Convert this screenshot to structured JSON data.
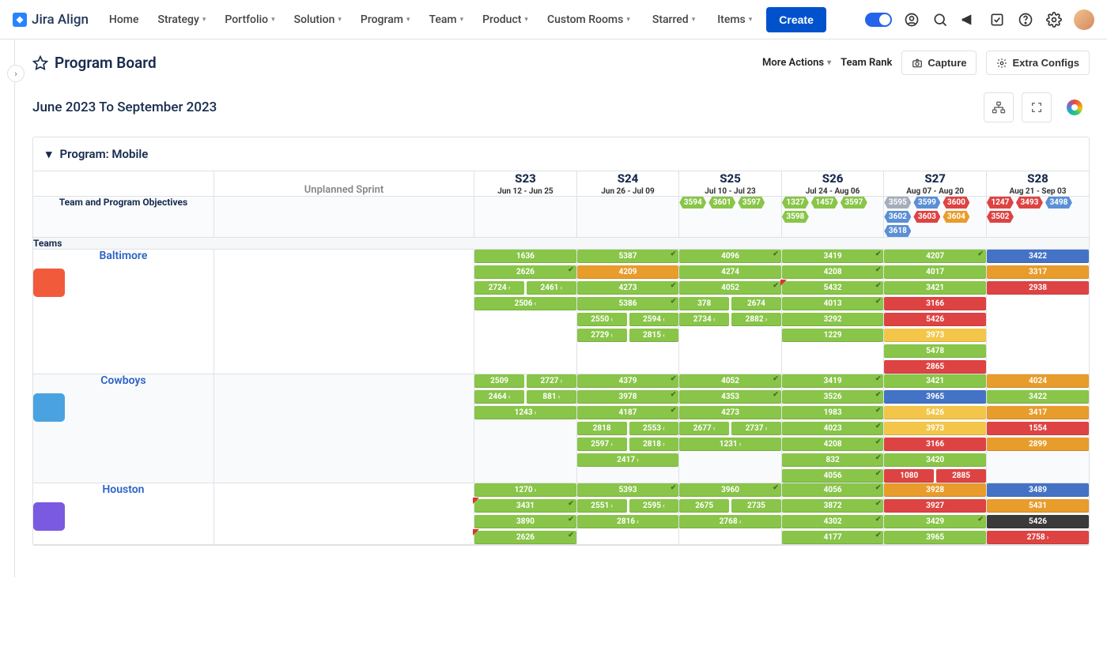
{
  "app": {
    "name": "Jira Align"
  },
  "nav": {
    "items": [
      "Home",
      "Strategy",
      "Portfolio",
      "Solution",
      "Program",
      "Team",
      "Product",
      "Custom Rooms"
    ],
    "items_dropdown": [
      false,
      true,
      true,
      true,
      true,
      true,
      true,
      true
    ],
    "starred": "Starred",
    "items_label": "Items",
    "create": "Create"
  },
  "header": {
    "title": "Program Board",
    "more_actions": "More Actions",
    "team_rank": "Team Rank",
    "capture": "Capture",
    "extra_configs": "Extra Configs"
  },
  "date_range": "June 2023 To September 2023",
  "board": {
    "program_label": "Program: Mobile",
    "unplanned_label": "Unplanned Sprint",
    "objectives_label": "Team and Program Objectives",
    "teams_label": "Teams",
    "sprints": [
      {
        "id": "S23",
        "range": "Jun 12 - Jun 25"
      },
      {
        "id": "S24",
        "range": "Jun 26 - Jul 09"
      },
      {
        "id": "S25",
        "range": "Jul 10 - Jul 23"
      },
      {
        "id": "S26",
        "range": "Jul 24 - Aug 06"
      },
      {
        "id": "S27",
        "range": "Aug 07 - Aug 20"
      },
      {
        "id": "S28",
        "range": "Aug 21 - Sep 03"
      }
    ],
    "objectives": {
      "S23": [],
      "S24": [],
      "S25": [
        {
          "id": "3594",
          "c": "green"
        },
        {
          "id": "3601",
          "c": "green"
        },
        {
          "id": "3597",
          "c": "green"
        }
      ],
      "S26": [
        {
          "id": "1327",
          "c": "green"
        },
        {
          "id": "1457",
          "c": "green"
        },
        {
          "id": "3597",
          "c": "green"
        },
        {
          "id": "3598",
          "c": "green"
        }
      ],
      "S27": [
        {
          "id": "3595",
          "c": "gray"
        },
        {
          "id": "3599",
          "c": "blue"
        },
        {
          "id": "3600",
          "c": "red"
        },
        {
          "id": "3602",
          "c": "blue"
        },
        {
          "id": "3603",
          "c": "red"
        },
        {
          "id": "3604",
          "c": "orange"
        },
        {
          "id": "3618",
          "c": "blue"
        }
      ],
      "S28": [
        {
          "id": "1247",
          "c": "red"
        },
        {
          "id": "3493",
          "c": "red"
        },
        {
          "id": "3498",
          "c": "blue"
        },
        {
          "id": "3502",
          "c": "red"
        }
      ]
    },
    "teams": [
      {
        "name": "Baltimore",
        "avatar_bg": "#f25a3c",
        "cells": {
          "S23": [
            {
              "id": "1636",
              "c": "green",
              "tick": false
            },
            {
              "id": "2626",
              "c": "green",
              "tick": true
            },
            {
              "pair": [
                {
                  "id": "2724",
                  "c": "green",
                  "arr": "‹"
                },
                {
                  "id": "2461",
                  "c": "green",
                  "arr": "‹"
                }
              ]
            },
            {
              "pair": [
                {
                  "id": "2506",
                  "c": "green",
                  "arr": "‹"
                }
              ]
            }
          ],
          "S24": [
            {
              "id": "5387",
              "c": "green",
              "tick": true
            },
            {
              "id": "4209",
              "c": "orange"
            },
            {
              "id": "4273",
              "c": "green",
              "tick": true
            },
            {
              "id": "5386",
              "c": "green",
              "tick": true
            },
            {
              "pair": [
                {
                  "id": "2550",
                  "c": "green",
                  "arr": "‹"
                },
                {
                  "id": "2594",
                  "c": "green",
                  "arr": "‹"
                }
              ]
            },
            {
              "pair": [
                {
                  "id": "2729",
                  "c": "green",
                  "arr": "‹"
                },
                {
                  "id": "2815",
                  "c": "green",
                  "arr": "‹"
                }
              ]
            }
          ],
          "S25": [
            {
              "id": "4096",
              "c": "green",
              "tick": true
            },
            {
              "id": "4274",
              "c": "green"
            },
            {
              "id": "4052",
              "c": "green",
              "tick": true
            },
            {
              "pair": [
                {
                  "id": "378",
                  "c": "green"
                },
                {
                  "id": "2674",
                  "c": "green"
                }
              ]
            },
            {
              "pair": [
                {
                  "id": "2734",
                  "c": "green",
                  "arr": "‹"
                },
                {
                  "id": "2882",
                  "c": "green",
                  "arr": "›"
                }
              ]
            }
          ],
          "S26": [
            {
              "id": "3419",
              "c": "green",
              "tick": true
            },
            {
              "id": "4208",
              "c": "green",
              "tick": true
            },
            {
              "id": "5432",
              "c": "green",
              "tick": true,
              "flag": true
            },
            {
              "id": "4013",
              "c": "green",
              "tick": true
            },
            {
              "id": "3292",
              "c": "green"
            },
            {
              "pair": [
                {
                  "id": "1229",
                  "c": "green"
                }
              ]
            }
          ],
          "S27": [
            {
              "id": "4207",
              "c": "green",
              "tick": true
            },
            {
              "id": "4017",
              "c": "green"
            },
            {
              "id": "3421",
              "c": "green"
            },
            {
              "id": "3166",
              "c": "red"
            },
            {
              "id": "5426",
              "c": "red"
            },
            {
              "id": "3973",
              "c": "yellow"
            },
            {
              "id": "5478",
              "c": "green"
            },
            {
              "pair": [
                {
                  "id": "2865",
                  "c": "red"
                }
              ]
            }
          ],
          "S28": [
            {
              "id": "3422",
              "c": "blue"
            },
            {
              "id": "3317",
              "c": "orange"
            },
            {
              "id": "2938",
              "c": "red"
            }
          ]
        }
      },
      {
        "name": "Cowboys",
        "avatar_bg": "#4aa3e0",
        "cells": {
          "S23": [
            {
              "pair": [
                {
                  "id": "2509",
                  "c": "green"
                },
                {
                  "id": "2727",
                  "c": "green",
                  "arr": "‹"
                }
              ]
            },
            {
              "pair": [
                {
                  "id": "2464",
                  "c": "green",
                  "arr": "‹"
                },
                {
                  "id": "881",
                  "c": "green",
                  "arr": "›"
                }
              ]
            },
            {
              "pair": [
                {
                  "id": "1243",
                  "c": "green",
                  "arr": "›"
                }
              ]
            }
          ],
          "S24": [
            {
              "id": "4379",
              "c": "green",
              "tick": true
            },
            {
              "id": "3978",
              "c": "green",
              "tick": true
            },
            {
              "id": "4187",
              "c": "green",
              "tick": true
            },
            {
              "pair": [
                {
                  "id": "2818",
                  "c": "green"
                },
                {
                  "id": "2553",
                  "c": "green",
                  "arr": "‹"
                }
              ]
            },
            {
              "pair": [
                {
                  "id": "2597",
                  "c": "green",
                  "arr": "›"
                },
                {
                  "id": "2818",
                  "c": "green",
                  "arr": "›"
                }
              ]
            },
            {
              "pair": [
                {
                  "id": "2417",
                  "c": "green",
                  "arr": "›"
                }
              ]
            }
          ],
          "S25": [
            {
              "id": "4052",
              "c": "green",
              "tick": true
            },
            {
              "id": "4353",
              "c": "green",
              "tick": true
            },
            {
              "id": "4273",
              "c": "green"
            },
            {
              "pair": [
                {
                  "id": "2677",
                  "c": "green",
                  "arr": "‹"
                },
                {
                  "id": "2737",
                  "c": "green",
                  "arr": "‹"
                }
              ]
            },
            {
              "pair": [
                {
                  "id": "1231",
                  "c": "green",
                  "arr": "›"
                }
              ]
            }
          ],
          "S26": [
            {
              "id": "3419",
              "c": "green",
              "tick": true
            },
            {
              "id": "3526",
              "c": "green",
              "tick": true
            },
            {
              "id": "1983",
              "c": "green",
              "tick": true
            },
            {
              "id": "4023",
              "c": "green",
              "tick": true
            },
            {
              "id": "4208",
              "c": "green",
              "tick": true
            },
            {
              "id": "832",
              "c": "green",
              "tick": true
            },
            {
              "id": "4056",
              "c": "green",
              "tick": true
            }
          ],
          "S27": [
            {
              "id": "3421",
              "c": "green"
            },
            {
              "id": "3965",
              "c": "blue"
            },
            {
              "id": "5426",
              "c": "yellow"
            },
            {
              "id": "3973",
              "c": "yellow"
            },
            {
              "id": "3166",
              "c": "red"
            },
            {
              "id": "3420",
              "c": "green"
            },
            {
              "pair": [
                {
                  "id": "1080",
                  "c": "red"
                },
                {
                  "id": "2885",
                  "c": "red"
                }
              ]
            }
          ],
          "S28": [
            {
              "id": "4024",
              "c": "orange"
            },
            {
              "id": "3422",
              "c": "green"
            },
            {
              "id": "3417",
              "c": "orange"
            },
            {
              "id": "1554",
              "c": "red"
            },
            {
              "pair": [
                {
                  "id": "2899",
                  "c": "orange"
                }
              ]
            }
          ]
        }
      },
      {
        "name": "Houston",
        "avatar_bg": "#7a5ae0",
        "cells": {
          "S23": [
            {
              "pair": [
                {
                  "id": "1270",
                  "c": "green",
                  "arr": "›"
                }
              ]
            },
            {
              "id": "3431",
              "c": "green",
              "tick": true,
              "flag": true
            },
            {
              "id": "3890",
              "c": "green",
              "tick": true
            },
            {
              "id": "2626",
              "c": "green",
              "tick": true,
              "flag": true
            }
          ],
          "S24": [
            {
              "id": "5393",
              "c": "green",
              "tick": true
            },
            {
              "pair": [
                {
                  "id": "2551",
                  "c": "green",
                  "arr": "‹"
                },
                {
                  "id": "2595",
                  "c": "green",
                  "arr": "‹"
                }
              ]
            },
            {
              "pair": [
                {
                  "id": "2816",
                  "c": "green",
                  "arr": "‹"
                }
              ]
            }
          ],
          "S25": [
            {
              "id": "3960",
              "c": "green",
              "tick": true
            },
            {
              "pair": [
                {
                  "id": "2675",
                  "c": "green"
                },
                {
                  "id": "2735",
                  "c": "green"
                }
              ]
            },
            {
              "pair": [
                {
                  "id": "2768",
                  "c": "green",
                  "arr": "‹"
                }
              ]
            }
          ],
          "S26": [
            {
              "id": "4056",
              "c": "green",
              "tick": true
            },
            {
              "id": "3872",
              "c": "green",
              "tick": true
            },
            {
              "id": "4302",
              "c": "green",
              "tick": true
            },
            {
              "id": "4177",
              "c": "green",
              "tick": true
            }
          ],
          "S27": [
            {
              "id": "3928",
              "c": "orange"
            },
            {
              "id": "3927",
              "c": "red"
            },
            {
              "id": "3429",
              "c": "green",
              "tick": true
            },
            {
              "id": "3965",
              "c": "green"
            }
          ],
          "S28": [
            {
              "id": "3489",
              "c": "blue"
            },
            {
              "id": "5431",
              "c": "orange"
            },
            {
              "id": "5426",
              "c": "dark"
            },
            {
              "pair": [
                {
                  "id": "2758",
                  "c": "red",
                  "arr": "›"
                }
              ]
            }
          ]
        }
      }
    ]
  }
}
